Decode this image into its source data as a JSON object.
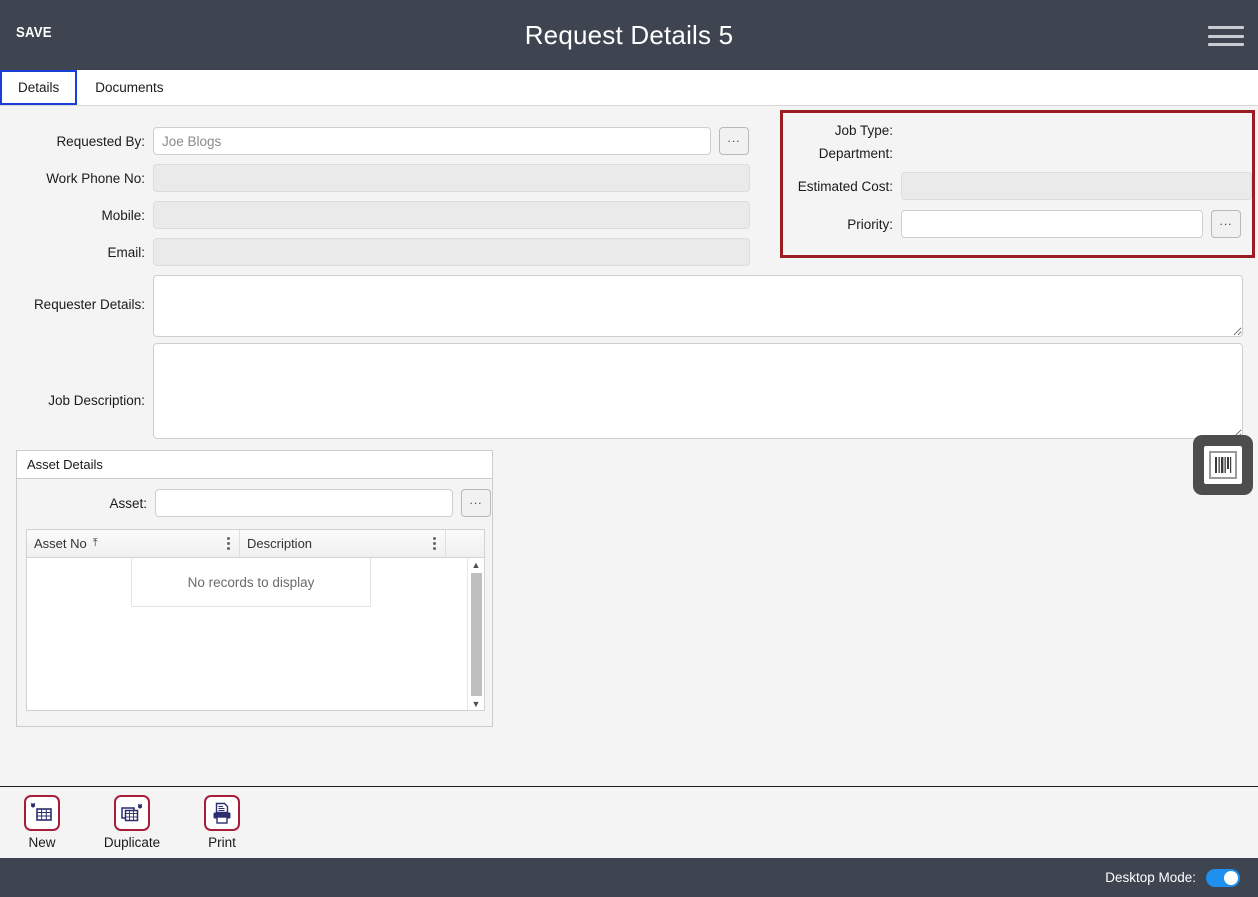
{
  "header": {
    "save_label": "SAVE",
    "title": "Request Details 5",
    "menu_icon": "hamburger-menu-icon"
  },
  "tabs": [
    {
      "label": "Details",
      "active": true
    },
    {
      "label": "Documents",
      "active": false
    }
  ],
  "form": {
    "left_fields": [
      {
        "label": "Requested By:",
        "value": "",
        "placeholder": "Joe Blogs",
        "disabled": false,
        "has_lookup": true
      },
      {
        "label": "Work Phone No:",
        "value": "",
        "placeholder": "",
        "disabled": true,
        "has_lookup": false
      },
      {
        "label": "Mobile:",
        "value": "",
        "placeholder": "",
        "disabled": true,
        "has_lookup": false
      },
      {
        "label": "Email:",
        "value": "",
        "placeholder": "",
        "disabled": true,
        "has_lookup": false
      }
    ],
    "textareas": [
      {
        "label": "Requester Details:",
        "value": ""
      },
      {
        "label": "Job Description:",
        "value": ""
      }
    ],
    "lookup_button_label": "..."
  },
  "highlight_panel": {
    "border_color": "#9b1c23",
    "fields": [
      {
        "label": "Job Type:",
        "value": "",
        "has_input": false,
        "disabled": false,
        "has_lookup": false
      },
      {
        "label": "Department:",
        "value": "",
        "has_input": false,
        "disabled": false,
        "has_lookup": false
      },
      {
        "label": "Estimated Cost:",
        "value": "",
        "has_input": true,
        "disabled": true,
        "has_lookup": false
      },
      {
        "label": "Priority:",
        "value": "",
        "has_input": true,
        "disabled": false,
        "has_lookup": true
      }
    ]
  },
  "asset_details": {
    "title": "Asset Details",
    "asset_label": "Asset:",
    "asset_value": "",
    "lookup_button_label": "...",
    "columns": [
      {
        "label": "Asset No",
        "sort": "asc",
        "sort_icon": "arrow-up-icon"
      },
      {
        "label": "Description",
        "sort": "",
        "sort_icon": ""
      }
    ],
    "empty_message": "No records to display",
    "scrollbar": {
      "up_icon": "triangle-up-icon",
      "down_icon": "triangle-down-icon"
    }
  },
  "barcode_button": {
    "icon": "barcode-scanner-icon",
    "background": "#4d4d4d"
  },
  "toolbar": {
    "accent_color": "#a81e3a",
    "items": [
      {
        "label": "New",
        "icon": "new-record-icon"
      },
      {
        "label": "Duplicate",
        "icon": "duplicate-record-icon"
      },
      {
        "label": "Print",
        "icon": "printer-icon"
      }
    ]
  },
  "statusbar": {
    "desktop_mode_label": "Desktop Mode:",
    "desktop_mode_on": true,
    "toggle_color": "#1e90f0"
  },
  "theme": {
    "header_bg": "#3e4450",
    "page_bg": "#f4f4f4",
    "accent_red": "#9b1c23",
    "tab_active_outline": "#1a3ed8"
  }
}
